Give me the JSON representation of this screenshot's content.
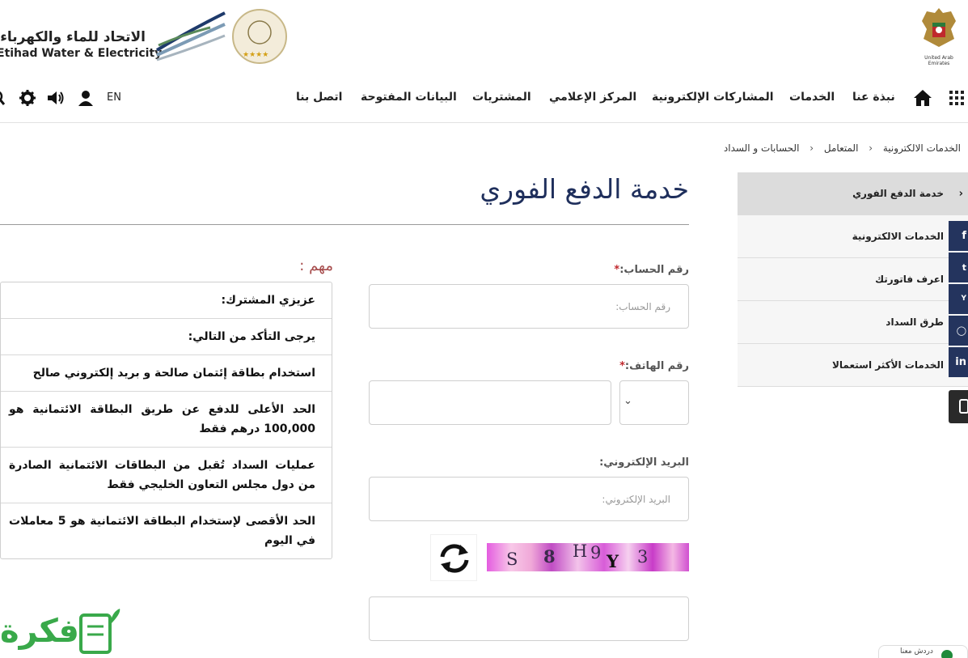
{
  "header": {
    "brand_ar": "الاتحاد للماء والكهرباء",
    "brand_en": "Etihad Water & Electricity",
    "emirates_caption": "United Arab Emirates"
  },
  "nav": {
    "home_icon": "home-icon",
    "items": [
      "نبذة عنا",
      "الخدمات",
      "المشاركات الإلكترونية",
      "المركز الإعلامي",
      "المشتريات",
      "البيانات المفتوحة",
      "اتصل بنا"
    ],
    "lang": "EN"
  },
  "breadcrumb": [
    "الخدمات الالكترونية",
    "المتعامل",
    "الحسابات و السداد"
  ],
  "page": {
    "title": "خدمة الدفع الفوري"
  },
  "important": {
    "label": "مهم :",
    "rows": [
      "عزيزي المشترك:",
      "يرجى التأكد من التالي:",
      "استخدام بطاقة إئتمان صالحة و بريد إلكتروني صالح",
      "الحد الأعلى للدفع عن طريق البطاقة الائتمانية هو 100,000 درهم فقط",
      "عمليات السداد تُقبل من البطاقات الائتمانية الصادرة من دول مجلس التعاون الخليجي فقط",
      "الحد الأقصى لإستخدام البطاقة الائتمانية هو 5 معاملات في اليوم"
    ]
  },
  "form": {
    "account_label": "رقم الحساب:",
    "account_placeholder": "رقم الحساب:",
    "phone_label": "رقم الهاتف:",
    "email_label": "البريد الإلكتروني:",
    "email_placeholder": "البريد الإلكتروني:",
    "required_mark": "*",
    "captcha_text": "S 8 H 9 Y 3",
    "captcha_chars": [
      "S",
      "8",
      "H",
      "9",
      "Y",
      "3"
    ]
  },
  "side_menu": {
    "items": [
      "خدمة الدفع الفوري",
      "الخدمات الالكترونية",
      "اعرف فاتورتك",
      "طرق السداد",
      "الخدمات الأكثر استعمالا"
    ],
    "active_index": 0
  },
  "social": [
    "facebook-icon",
    "twitter-icon",
    "youtube-icon",
    "instagram-icon",
    "linkedin-icon"
  ],
  "chat": {
    "label": "دردش معنا"
  },
  "watermark": {
    "text": "فكرة"
  },
  "colors": {
    "title": "#1f2f5c",
    "important": "#a64b4b",
    "required": "#c0282d",
    "social_bg": "#24345e",
    "watermark": "#39a94a"
  }
}
